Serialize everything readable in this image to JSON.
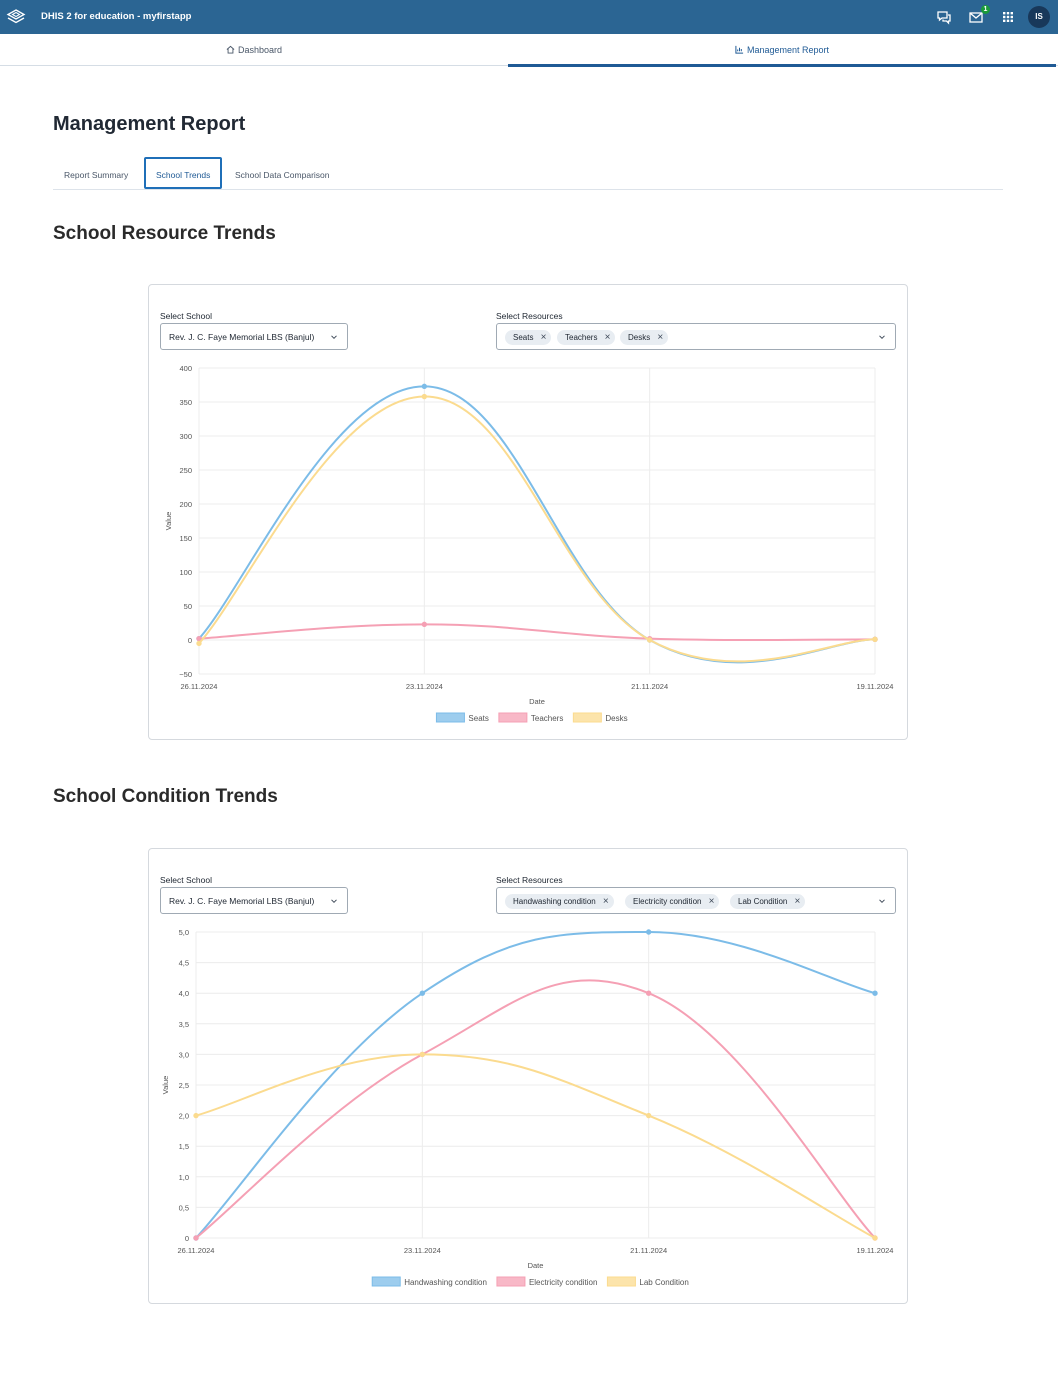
{
  "header": {
    "app_title": "DHIS 2 for education - myfirstapp",
    "messages_count": "1",
    "profile_initials": "IS",
    "brand_color": "#2b6593"
  },
  "nav": {
    "dashboard_label": "Dashboard",
    "management_report_label": "Management Report"
  },
  "page": {
    "title": "Management Report",
    "tabs": [
      "Report Summary",
      "School Trends",
      "School Data Comparison"
    ],
    "active_tab": "School Trends"
  },
  "resource_section": {
    "title": "School Resource Trends",
    "school_label": "Select School",
    "school_value": "Rev. J. C. Faye Memorial LBS (Banjul)",
    "resources_label": "Select Resources",
    "chips": [
      "Seats",
      "Teachers",
      "Desks"
    ]
  },
  "condition_section": {
    "title": "School Condition Trends",
    "school_label": "Select School",
    "school_value": "Rev. J. C. Faye Memorial LBS (Banjul)",
    "resources_label": "Select Resources",
    "chips": [
      "Handwashing condition",
      "Electricity condition",
      "Lab Condition"
    ]
  },
  "chart_data": [
    {
      "type": "line",
      "x": [
        "26.11.2024",
        "23.11.2024",
        "21.11.2024",
        "19.11.2024"
      ],
      "xlabel": "Date",
      "ylabel": "Value",
      "ylim": [
        -50,
        400
      ],
      "yticks": [
        "400",
        "350",
        "300",
        "250",
        "200",
        "150",
        "100",
        "50",
        "0",
        "−50"
      ],
      "ytick_values": [
        400,
        350,
        300,
        250,
        200,
        150,
        100,
        50,
        0,
        -50
      ],
      "grid": true,
      "legend_position": "bottom",
      "series": [
        {
          "name": "Seats",
          "values": [
            2,
            373,
            0,
            1
          ],
          "color": "#7cbce8"
        },
        {
          "name": "Teachers",
          "values": [
            2,
            23,
            2,
            1
          ],
          "color": "#f5a0b4"
        },
        {
          "name": "Desks",
          "values": [
            -5,
            358,
            0,
            1
          ],
          "color": "#fbdb8f"
        }
      ]
    },
    {
      "type": "line",
      "x": [
        "26.11.2024",
        "23.11.2024",
        "21.11.2024",
        "19.11.2024"
      ],
      "xlabel": "Date",
      "ylabel": "Value",
      "ylim": [
        0,
        5
      ],
      "yticks": [
        "5,0",
        "4,5",
        "4,0",
        "3,5",
        "3,0",
        "2,5",
        "2,0",
        "1,5",
        "1,0",
        "0,5",
        "0"
      ],
      "ytick_values": [
        5,
        4.5,
        4,
        3.5,
        3,
        2.5,
        2,
        1.5,
        1,
        0.5,
        0
      ],
      "grid": true,
      "legend_position": "bottom",
      "series": [
        {
          "name": "Handwashing condition",
          "values": [
            0,
            4,
            5,
            4
          ],
          "color": "#7cbce8"
        },
        {
          "name": "Electricity condition",
          "values": [
            0,
            3,
            4,
            0
          ],
          "color": "#f5a0b4"
        },
        {
          "name": "Lab Condition",
          "values": [
            2,
            3,
            2,
            0
          ],
          "color": "#fbdb8f"
        }
      ]
    }
  ]
}
